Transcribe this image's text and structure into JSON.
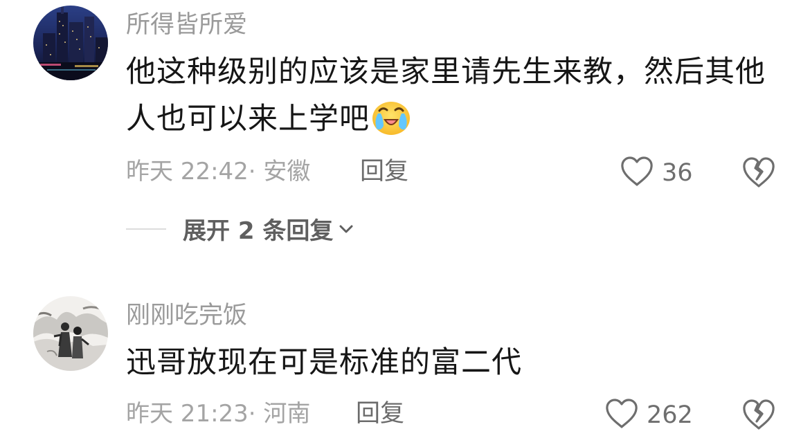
{
  "comments": [
    {
      "username": "所得皆所爱",
      "text": "他这种级别的应该是家里请先生来教，然后其他人也可以来上学吧",
      "emoji_icon": "crying-laughing-emoji-icon",
      "time": "昨天 22:42",
      "location": "安徽",
      "meta": "昨天 22:42· 安徽",
      "reply_label": "回复",
      "likes": "36",
      "expand_label": "展开 2 条回复"
    },
    {
      "username": "刚刚吃完饭",
      "text": "迅哥放现在可是标准的富二代",
      "time": "昨天 21:23",
      "location": "河南",
      "meta": "昨天 21:23· 河南",
      "reply_label": "回复",
      "likes": "262"
    }
  ],
  "icons": {
    "like": "heart-outline-icon",
    "dislike": "broken-heart-icon",
    "expand": "chevron-down-icon"
  },
  "colors": {
    "username": "#9a9a9a",
    "text": "#161616",
    "meta": "#a4a4a4",
    "action": "#6b6b6b"
  }
}
